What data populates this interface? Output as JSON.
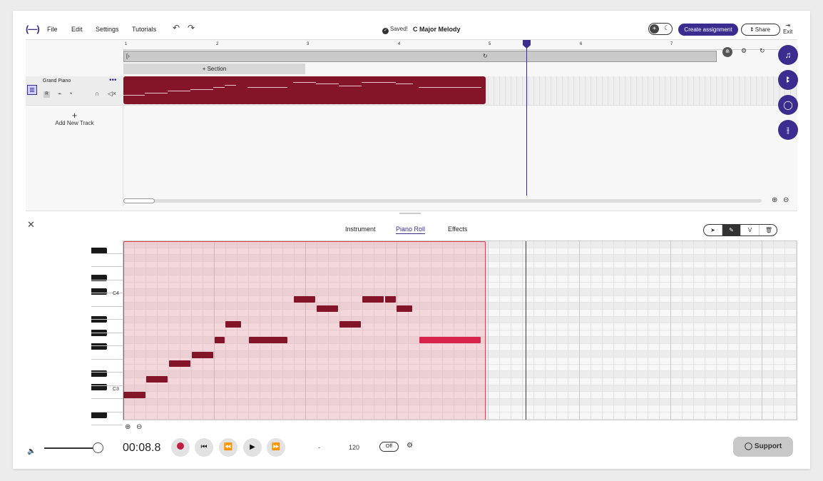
{
  "topbar": {
    "logo": "(—)",
    "menu": [
      "File",
      "Edit",
      "Settings",
      "Tutorials"
    ],
    "saved_label": "Saved!",
    "project_title": "C Major Melody",
    "create_assignment_label": "Create assignment",
    "share_label": "Share",
    "exit_label": "Exit"
  },
  "ruler": {
    "bars": [
      "1",
      "2",
      "3",
      "4",
      "5",
      "6",
      "7"
    ]
  },
  "arrange": {
    "section_label": "+ Section",
    "track_name": "Grand Piano",
    "record_label": "R",
    "add_track_label": "Add New Track"
  },
  "editor": {
    "tabs": [
      "Instrument",
      "Piano Roll",
      "Effects"
    ],
    "active_tab": "Piano Roll",
    "tools": [
      "select-icon",
      "pencil-icon",
      "V",
      "trash-icon"
    ],
    "key_labels": [
      "C4",
      "C3"
    ]
  },
  "transport": {
    "time": "00:08.8",
    "dash": "-",
    "tempo": "120",
    "metronome": "Off",
    "support_label": "Support"
  },
  "colors": {
    "accent": "#3b2d8f",
    "clip": "#841427",
    "note_selected": "#d9234a",
    "record": "#c21d3f"
  }
}
